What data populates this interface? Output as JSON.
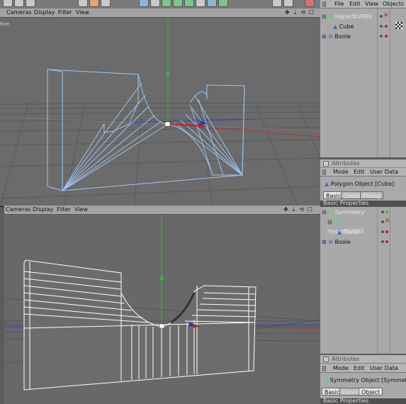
{
  "viewport_top": {
    "menu": [
      "Cameras",
      "Display",
      "Filter",
      "View"
    ],
    "side_label": "tive"
  },
  "viewport_bottom": {
    "menu": [
      "Cameras",
      "Display",
      "Filter",
      "View"
    ]
  },
  "objects_top": {
    "menu": [
      "File",
      "Edit",
      "View",
      "Objects"
    ],
    "items": [
      {
        "label": "HyperNURBS",
        "state": "disabled"
      },
      {
        "label": "Cube",
        "state": "normal"
      },
      {
        "label": "Boole",
        "state": "normal"
      }
    ]
  },
  "attributes_top": {
    "header": "Attributes",
    "menu": [
      "Mode",
      "Edit",
      "User Data"
    ],
    "object_title": "Polygon Object [Cube]",
    "tabs": [
      "Basic",
      "Coord.",
      "Phong"
    ],
    "section": "Basic Properties"
  },
  "objects_bottom": {
    "items": [
      {
        "label": "Symmetry",
        "state": "normal"
      },
      {
        "label": "HyperNURBS",
        "state": "disabled"
      },
      {
        "label": "Cube",
        "state": "disabled"
      },
      {
        "label": "Boole",
        "state": "normal"
      }
    ]
  },
  "attributes_bottom": {
    "header": "Attributes",
    "menu": [
      "Mode",
      "Edit",
      "User Data"
    ],
    "object_title": "Symmetry Object [Symmetry]",
    "tabs": [
      "Basic",
      "Coord.",
      "Object"
    ],
    "section": "Basic Properties"
  },
  "colors": {
    "selection": "#9cc4f2",
    "y_axis": "#1ec81e",
    "x_axis": "#e02020",
    "z_axis": "#2030d0",
    "panel_bg": "#a9a9a9"
  }
}
